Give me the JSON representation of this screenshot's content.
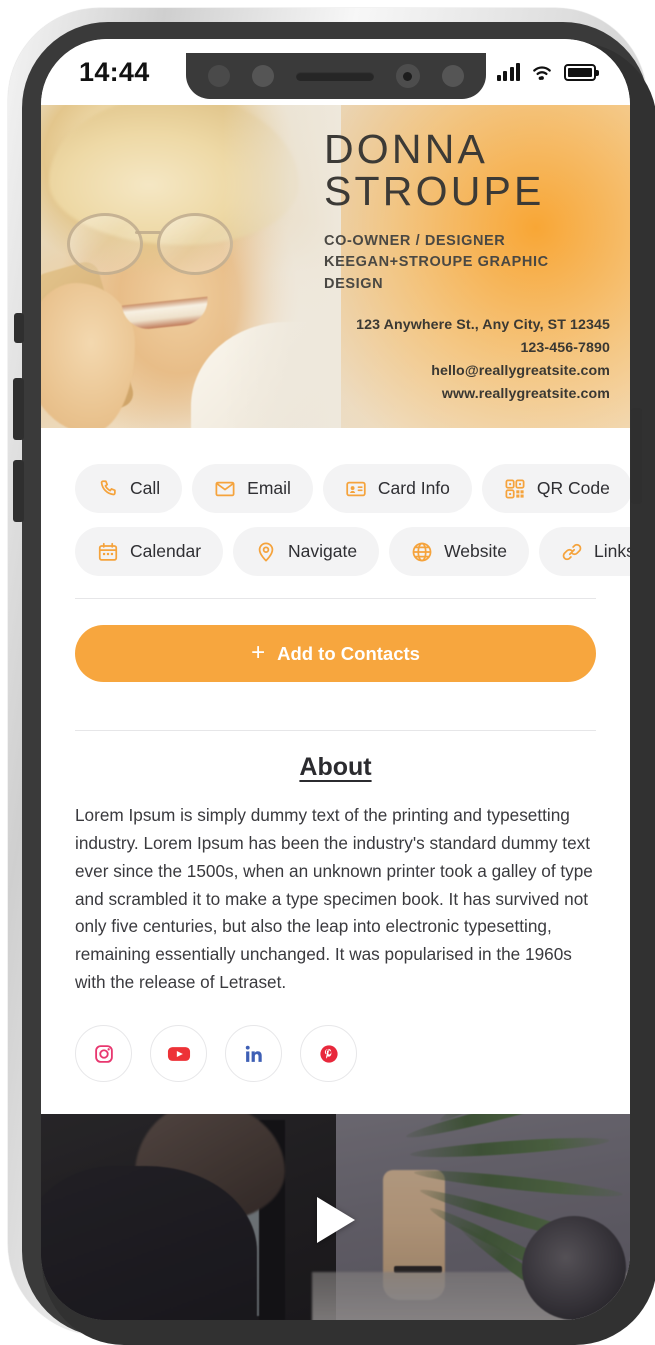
{
  "status_bar": {
    "time": "14:44",
    "signal_icon": "signal-bars-icon",
    "wifi_icon": "wifi-icon",
    "battery_icon": "battery-full-icon"
  },
  "hero": {
    "first_name": "DONNA",
    "last_name": "STROUPE",
    "role_line_1": "CO-OWNER / DESIGNER",
    "role_line_2": "KEEGAN+STROUPE GRAPHIC DESIGN",
    "address": "123 Anywhere St., Any City, ST 12345",
    "phone": "123-456-7890",
    "email": "hello@reallygreatsite.com",
    "website": "www.reallygreatsite.com",
    "accent_color": "#F9A32D"
  },
  "actions": {
    "row_1": [
      {
        "label": "Call",
        "icon": "phone-icon"
      },
      {
        "label": "Email",
        "icon": "envelope-icon"
      },
      {
        "label": "Card Info",
        "icon": "id-card-icon"
      },
      {
        "label": "QR Code",
        "icon": "qr-code-icon"
      }
    ],
    "row_2": [
      {
        "label": "Calendar",
        "icon": "calendar-icon"
      },
      {
        "label": "Navigate",
        "icon": "map-pin-icon"
      },
      {
        "label": "Website",
        "icon": "globe-icon"
      },
      {
        "label": "Links",
        "icon": "link-icon"
      }
    ]
  },
  "cta": {
    "label": "Add to Contacts",
    "plus": "+",
    "background_color": "#F7A63E",
    "text_color": "#FFFFFF"
  },
  "about": {
    "title": "About",
    "body": "Lorem Ipsum is simply dummy text of the printing and typesetting industry. Lorem Ipsum has been the industry's standard dummy text ever since the 1500s, when an unknown printer took a galley of type and scrambled it to make a type specimen book. It has survived not only five centuries, but also the leap into electronic typesetting, remaining essentially unchanged. It was popularised in the 1960s with the release of Letraset."
  },
  "socials": [
    {
      "name": "instagram",
      "icon": "instagram-icon",
      "color": "#E8376F"
    },
    {
      "name": "youtube",
      "icon": "youtube-icon",
      "color": "#ED3237"
    },
    {
      "name": "linkedin",
      "icon": "linkedin-icon",
      "color": "#3E5FB5"
    },
    {
      "name": "pinterest",
      "icon": "pinterest-icon",
      "color": "#E8283C"
    }
  ],
  "video": {
    "play_icon": "play-triangle-icon"
  }
}
